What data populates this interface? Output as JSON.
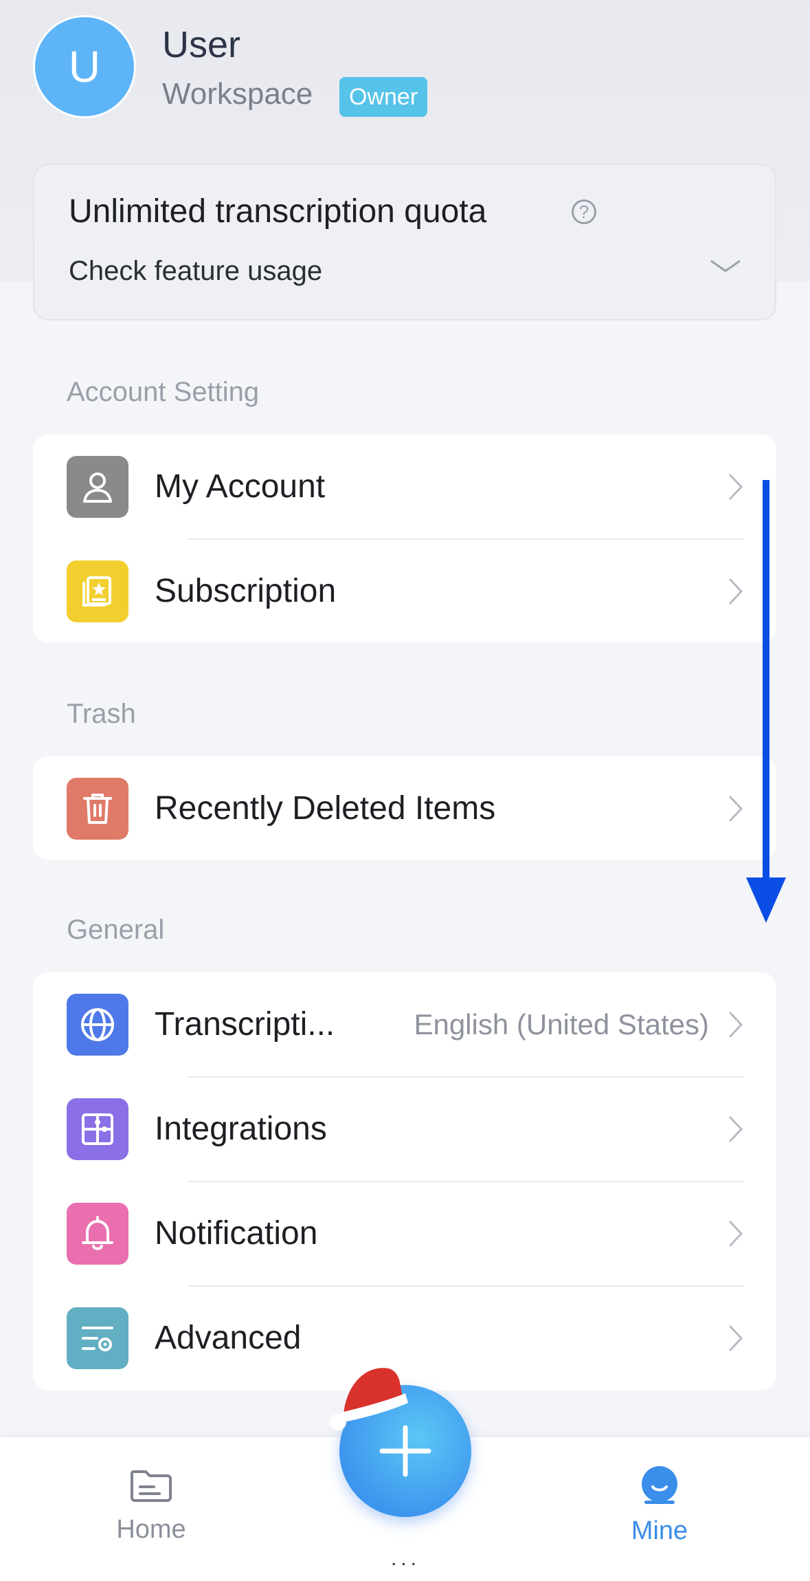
{
  "header": {
    "avatar_letter": "U",
    "user_name": "User",
    "workspace": "Workspace",
    "role_badge": "Owner"
  },
  "quota": {
    "title": "Unlimited transcription quota",
    "help_glyph": "?",
    "subtitle": "Check feature usage"
  },
  "sections": {
    "account": {
      "label": "Account Setting",
      "items": [
        {
          "label": "My Account",
          "icon": "user-icon",
          "color": "#8a8a8c"
        },
        {
          "label": "Subscription",
          "icon": "subscription-icon",
          "color": "#f2cf2e"
        }
      ]
    },
    "trash": {
      "label": "Trash",
      "items": [
        {
          "label": "Recently Deleted Items",
          "icon": "trash-icon",
          "color": "#e07a68"
        }
      ]
    },
    "general": {
      "label": "General",
      "items": [
        {
          "label": "Transcripti...",
          "value": "English (United States)",
          "icon": "globe-icon",
          "color": "#4f79e8"
        },
        {
          "label": "Integrations",
          "icon": "puzzle-icon",
          "color": "#8b6fe6"
        },
        {
          "label": "Notification",
          "icon": "bell-icon",
          "color": "#e96fae"
        },
        {
          "label": "Advanced",
          "icon": "settings-sliders-icon",
          "color": "#62aec2"
        }
      ]
    }
  },
  "bottom_nav": {
    "home_label": "Home",
    "mine_label": "Mine",
    "active": "Mine",
    "fab_dots": "..."
  },
  "colors": {
    "accent": "#3b8ee9",
    "badge": "#56c3e8",
    "scroll_arrow": "#0a4ee6"
  }
}
